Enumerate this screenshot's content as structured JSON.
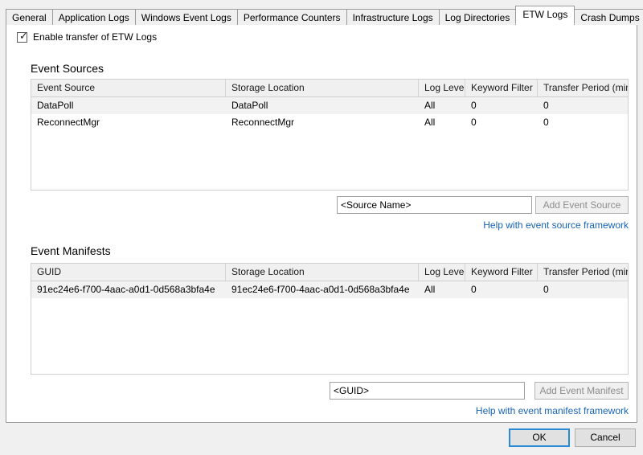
{
  "tabs": [
    {
      "label": "General",
      "selected": false
    },
    {
      "label": "Application Logs",
      "selected": false
    },
    {
      "label": "Windows Event Logs",
      "selected": false
    },
    {
      "label": "Performance Counters",
      "selected": false
    },
    {
      "label": "Infrastructure Logs",
      "selected": false
    },
    {
      "label": "Log Directories",
      "selected": false
    },
    {
      "label": "ETW Logs",
      "selected": true
    },
    {
      "label": "Crash Dumps",
      "selected": false
    }
  ],
  "enable_checkbox": {
    "label": "Enable transfer of ETW Logs",
    "checked": true,
    "tick_glyph": "✓"
  },
  "event_sources": {
    "title": "Event Sources",
    "columns": [
      "Event Source",
      "Storage Location",
      "Log Level",
      "Keyword Filter",
      "Transfer Period (min)"
    ],
    "rows": [
      [
        "DataPoll",
        "DataPoll",
        "All",
        "0",
        "0"
      ],
      [
        "ReconnectMgr",
        "ReconnectMgr",
        "All",
        "0",
        "0"
      ]
    ],
    "input_placeholder": "<Source Name>",
    "input_value": "",
    "add_button_label": "Add Event Source",
    "add_button_enabled": false,
    "help_link": "Help with event source framework"
  },
  "event_manifests": {
    "title": "Event Manifests",
    "columns": [
      "GUID",
      "Storage Location",
      "Log Level",
      "Keyword Filter",
      "Transfer Period (min)"
    ],
    "rows": [
      [
        "91ec24e6-f700-4aac-a0d1-0d568a3bfa4e",
        "91ec24e6-f700-4aac-a0d1-0d568a3bfa4e",
        "All",
        "0",
        "0"
      ]
    ],
    "input_placeholder": "<GUID>",
    "input_value": "",
    "add_button_label": "Add Event Manifest",
    "add_button_enabled": false,
    "help_link": "Help with event manifest framework"
  },
  "footer": {
    "ok_label": "OK",
    "cancel_label": "Cancel"
  },
  "colors": {
    "link": "#1763b5",
    "focus_border": "#2a8ad4",
    "panel_bg": "#ffffff",
    "window_bg": "#f0f0f0",
    "grid_header_bg": "#f0f0f0",
    "row_alt_bg": "#f2f2f2"
  }
}
